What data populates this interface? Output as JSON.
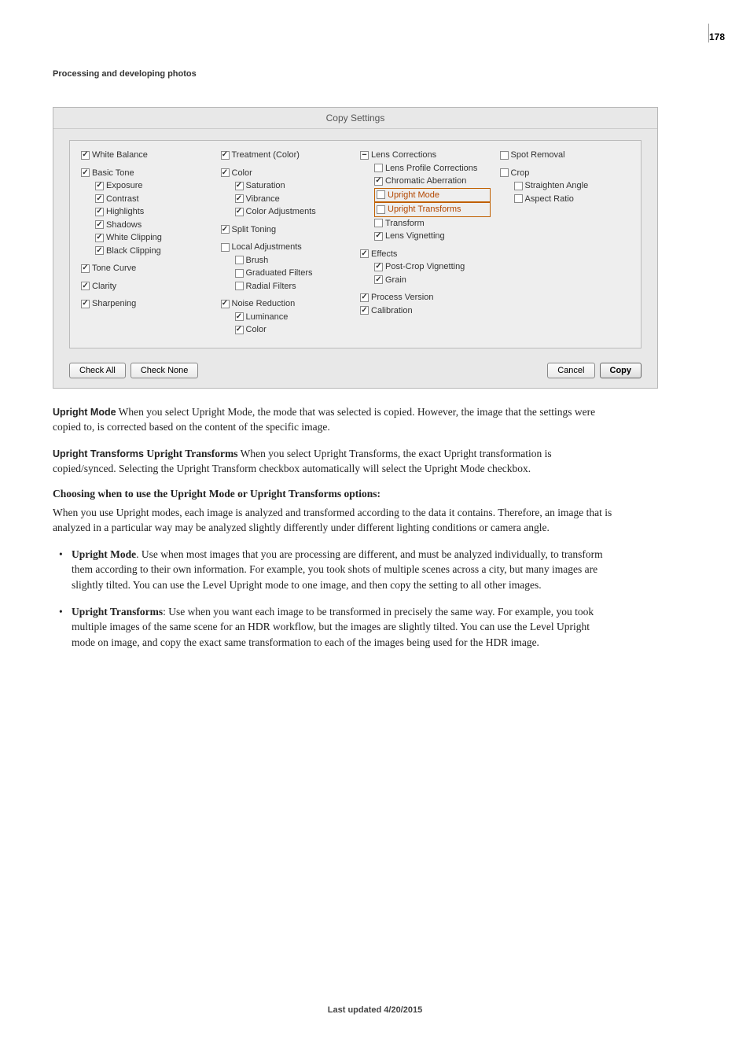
{
  "page_number": "178",
  "header": "Processing and developing photos",
  "dialog": {
    "title": "Copy Settings",
    "cols": {
      "c1": {
        "white_balance": "White Balance",
        "basic_tone": "Basic Tone",
        "exposure": "Exposure",
        "contrast": "Contrast",
        "highlights": "Highlights",
        "shadows": "Shadows",
        "white_clipping": "White Clipping",
        "black_clipping": "Black Clipping",
        "tone_curve": "Tone Curve",
        "clarity": "Clarity",
        "sharpening": "Sharpening"
      },
      "c2": {
        "treatment": "Treatment (Color)",
        "color": "Color",
        "saturation": "Saturation",
        "vibrance": "Vibrance",
        "color_adj": "Color Adjustments",
        "split_toning": "Split Toning",
        "local_adj": "Local Adjustments",
        "brush": "Brush",
        "grad_filters": "Graduated Filters",
        "radial_filters": "Radial Filters",
        "noise_red": "Noise Reduction",
        "luminance": "Luminance",
        "nr_color": "Color"
      },
      "c3": {
        "lens_corr": "Lens Corrections",
        "lens_profile": "Lens Profile Corrections",
        "chrom_ab": "Chromatic Aberration",
        "upright_mode": "Upright Mode",
        "upright_trans": "Upright Transforms",
        "transform": "Transform",
        "lens_vig": "Lens Vignetting",
        "effects": "Effects",
        "post_crop_vig": "Post-Crop Vignetting",
        "grain": "Grain",
        "process_ver": "Process Version",
        "calibration": "Calibration"
      },
      "c4": {
        "spot_removal": "Spot Removal",
        "crop": "Crop",
        "straighten": "Straighten Angle",
        "aspect": "Aspect Ratio"
      }
    },
    "buttons": {
      "check_all": "Check All",
      "check_none": "Check None",
      "cancel": "Cancel",
      "copy": "Copy"
    }
  },
  "paragraphs": {
    "p1_label": "Upright Mode",
    "p1": "  When you select Upright Mode, the mode that was selected is copied. However, the image that the settings were copied to, is corrected based on the content of the specific image.",
    "p2_label": "Upright Transforms",
    "p2_label2": "  Upright Transforms",
    "p2": " When you select Upright Transforms, the exact Upright transformation is copied/synced. Selecting the Upright Transform checkbox automatically will select the Upright Mode checkbox.",
    "p3_head": "Choosing when to use the Upright Mode or Upright Transforms options:",
    "p4": "When you use Upright modes, each image is analyzed and transformed according to the data it contains. Therefore, an image that is analyzed in a particular way may be analyzed slightly differently under different lighting conditions or camera angle.",
    "b1_label": "Upright Mode",
    "b1": ". Use when most images that you are processing are different, and must be analyzed individually, to transform them according to their own information. For example, you took shots of multiple scenes across a city, but many images are slightly tilted. You can use the Level Upright mode to one image, and then copy the setting to all other images.",
    "b2_label": "Upright Transforms",
    "b2": ": Use when you want each image to be transformed in precisely the same way. For example, you took multiple images of the same scene for an HDR workflow, but the images are slightly tilted. You can use the Level Upright mode on image, and copy the exact same transformation to each of the images being used for the HDR image."
  },
  "footer": "Last updated 4/20/2015"
}
